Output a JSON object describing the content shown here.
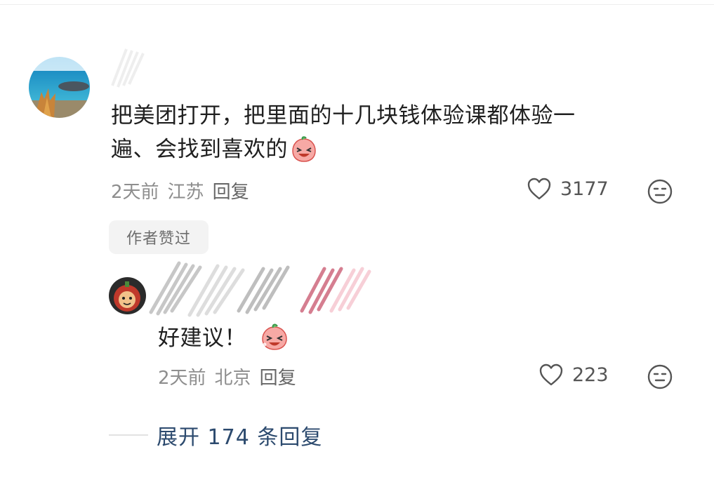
{
  "comment": {
    "text_line1": "把美团打开，把里面的十几块钱体验课都体验一",
    "text_line2": "遍、会找到喜欢的",
    "time": "2天前",
    "location": "江苏",
    "reply_label": "回复",
    "likes": "3177",
    "author_liked_badge": "作者赞过"
  },
  "reply": {
    "text": "好建议！",
    "time": "2天前",
    "location": "北京",
    "reply_label": "回复",
    "likes": "223"
  },
  "expand_label": "展开 174 条回复",
  "icons": {
    "like": "heart-outline-icon",
    "dislike": "meh-face-icon",
    "emoji_comment": "laughing-peach-emoji",
    "emoji_reply": "laughing-peach-emoji"
  },
  "colors": {
    "expand_text": "#2c4a6e",
    "meta_text": "#8e8e8e",
    "badge_bg": "#f3f3f3"
  }
}
